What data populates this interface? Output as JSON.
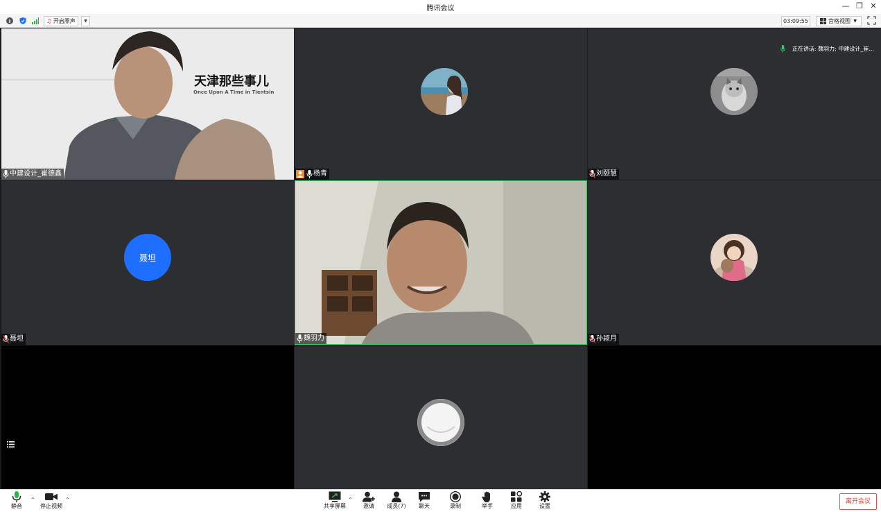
{
  "window": {
    "title": "腾讯会议"
  },
  "toolbar": {
    "sound_label": "开启原声",
    "timer": "03:09:55",
    "view_label": "宫格视图"
  },
  "speaking": {
    "text": "正在讲话: 魏羽力; 中建设计_崔..."
  },
  "slide": {
    "title": "天津那些事儿",
    "subtitle": "Once Upon A Time in Tientsin"
  },
  "tiles": [
    {
      "name": "中建设计_崔德鑫"
    },
    {
      "name": "杨青"
    },
    {
      "name": "刘颐慧"
    },
    {
      "name": "聂坦",
      "avatar_text": "聂坦"
    },
    {
      "name": "魏羽力"
    },
    {
      "name": "孙颍月"
    }
  ],
  "bottombar": {
    "mute": "静音",
    "stop_video": "停止视频",
    "share": "共享屏幕",
    "invite": "邀请",
    "members": "成员(7)",
    "chat": "聊天",
    "record": "录制",
    "raise_hand": "举手",
    "apps": "应用",
    "settings": "设置",
    "leave": "离开会议"
  },
  "colors": {
    "accent_blue": "#1e6fff",
    "active_border": "#3ec46d",
    "leave_red": "#e43f3f",
    "tile_bg": "#2c2e32"
  }
}
